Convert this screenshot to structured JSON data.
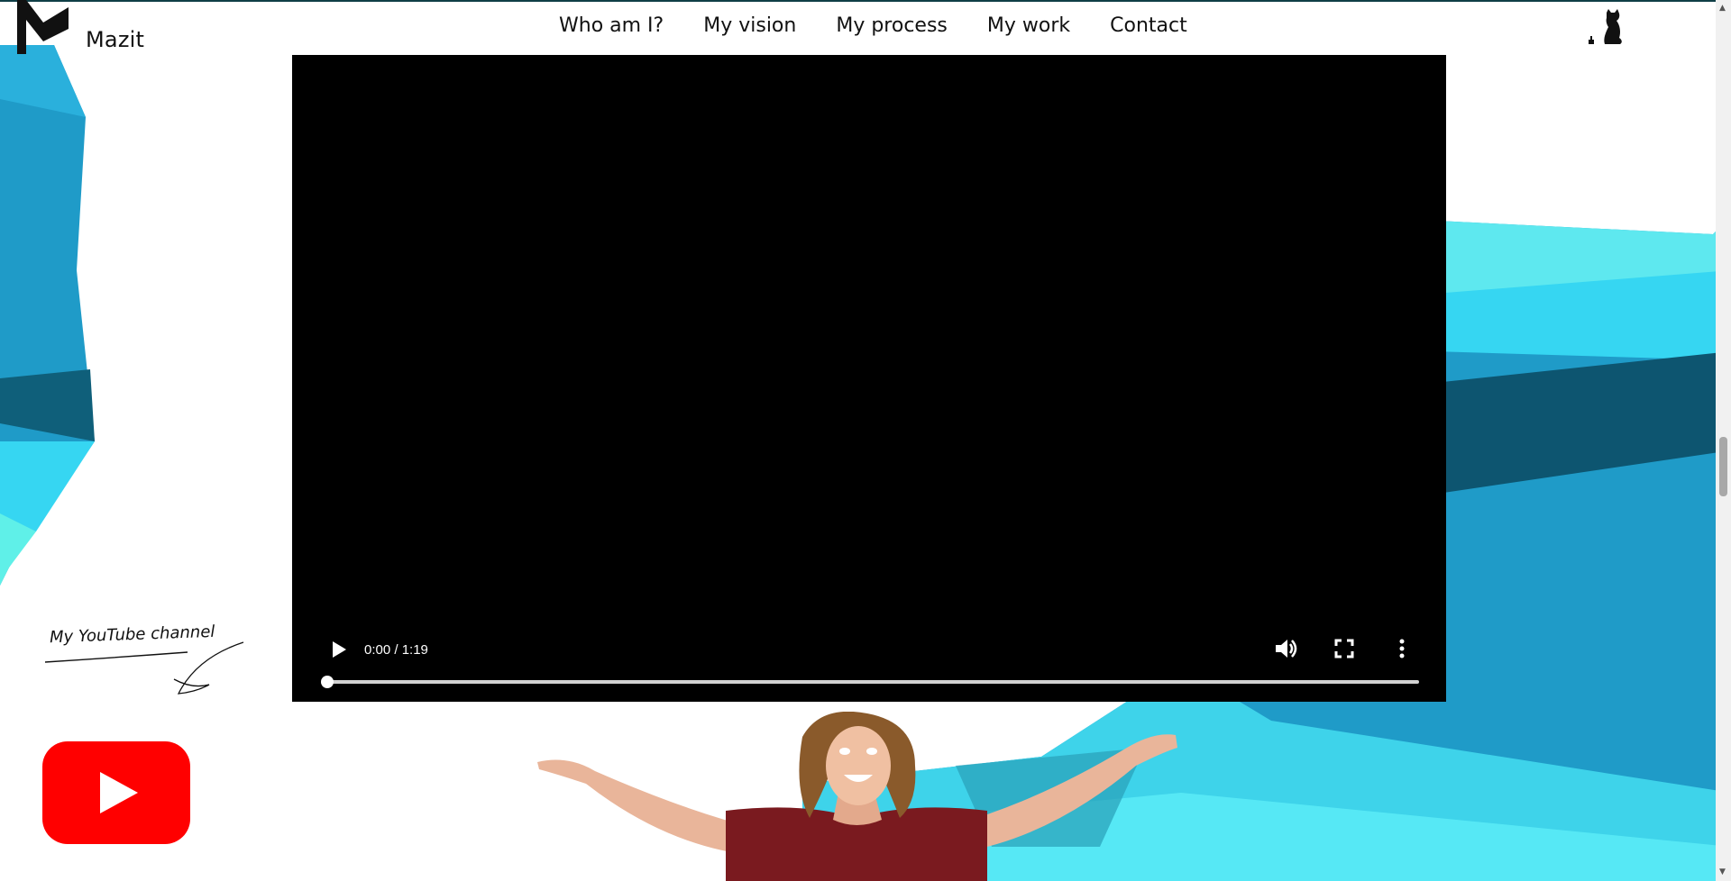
{
  "header": {
    "brand": "Mazit",
    "nav": [
      "Who am I?",
      "My vision",
      "My process",
      "My work",
      "Contact"
    ]
  },
  "video": {
    "time": "0:00 / 1:19",
    "progress": 0,
    "icons": {
      "play": "play-icon",
      "volume": "volume-icon",
      "fullscreen": "fullscreen-icon",
      "more": "more-icon"
    }
  },
  "youtube": {
    "caption": "My YouTube channel",
    "logo_color": "#ff0000"
  },
  "colors": {
    "accent_cyan": "#3fe3f5",
    "accent_blue": "#1f9bc8",
    "dark_teal": "#0f3e46"
  }
}
